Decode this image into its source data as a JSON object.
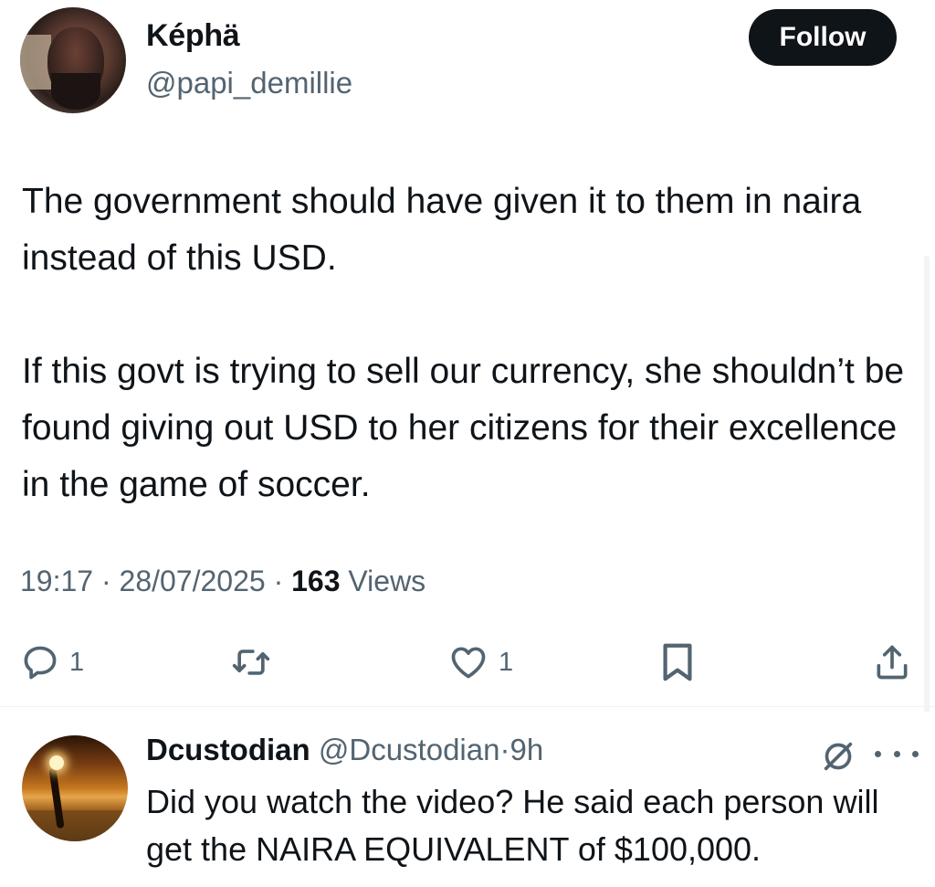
{
  "tweet": {
    "author": {
      "display_name": "Képhä",
      "handle": "@papi_demillie",
      "avatar_icon": "user-avatar-photo"
    },
    "follow_label": "Follow",
    "text_paragraphs": [
      "The government should have given it to them in naira instead of this USD.",
      "If this govt is trying to sell our currency, she shouldn’t be found giving out USD to her citizens for their excellence in the game of soccer."
    ],
    "time": "19:17",
    "date": "28/07/2025",
    "views_count": "163",
    "views_label": "Views",
    "separator": "·",
    "actions": {
      "reply_count": "1",
      "retweet_count": "",
      "like_count": "1"
    }
  },
  "reply": {
    "display_name": "Dcustodian",
    "handle": "@Dcustodian",
    "separator": "·",
    "time": "9h",
    "text": "Did you watch the video? He said each person will get the NAIRA EQUIVALENT of $100,000.",
    "avatar_icon": "sunset-beach-photo"
  },
  "colors": {
    "text_primary": "#0f1419",
    "text_secondary": "#536471",
    "follow_bg": "#0f1419",
    "divider": "#eff3f4"
  }
}
